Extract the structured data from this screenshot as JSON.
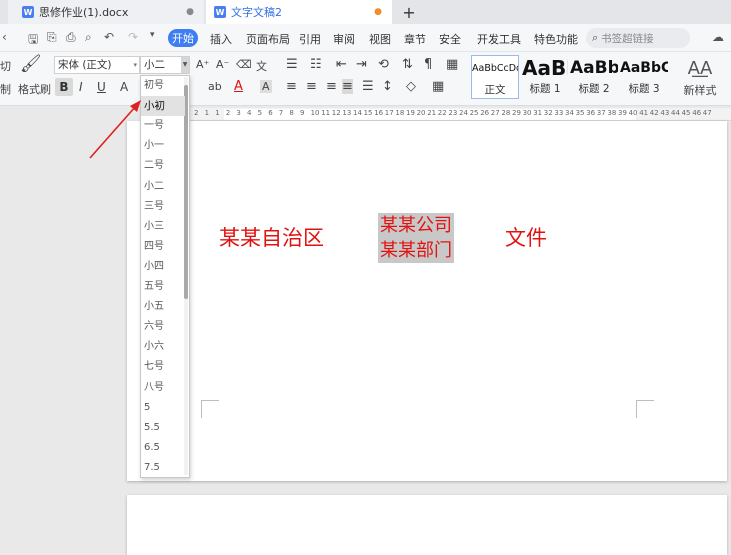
{
  "tabs": [
    {
      "label": "思修作业(1).docx",
      "icon": "W",
      "close": "●"
    },
    {
      "label": "文字文稿2",
      "icon": "W",
      "close": "●"
    }
  ],
  "tab_add": "+",
  "menu": {
    "active": "开始",
    "items": [
      "插入",
      "页面布局",
      "引用",
      "审阅",
      "视图",
      "章节",
      "安全",
      "开发工具",
      "特色功能"
    ],
    "search_placeholder": "书签超链接"
  },
  "ribbon": {
    "cut_partial": "切",
    "copy_partial": "制",
    "format_painter": "格式刷",
    "font_name": "宋体 (正文)",
    "font_size": "小二",
    "styles": [
      {
        "preview": "AaBbCcDd",
        "label": "正文"
      },
      {
        "preview": "AaBb",
        "label": "标题 1"
      },
      {
        "preview": "AaBb(",
        "label": "标题 2"
      },
      {
        "preview": "AaBbC",
        "label": "标题 3"
      }
    ],
    "new_style": "新样式"
  },
  "ruler_labels": [
    "2",
    "1",
    "1",
    "2",
    "3",
    "4",
    "5",
    "6",
    "7",
    "8",
    "9",
    "10",
    "11",
    "12",
    "13",
    "14",
    "15",
    "16",
    "17",
    "18",
    "19",
    "20",
    "21",
    "22",
    "23",
    "24",
    "25",
    "26",
    "27",
    "28",
    "29",
    "30",
    "31",
    "32",
    "33",
    "34",
    "35",
    "36",
    "37",
    "38",
    "39",
    "40",
    "41",
    "42",
    "43",
    "44",
    "45",
    "46",
    "47"
  ],
  "size_options": [
    "初号",
    "小初",
    "一号",
    "小一",
    "二号",
    "小二",
    "三号",
    "小三",
    "四号",
    "小四",
    "五号",
    "小五",
    "六号",
    "小六",
    "七号",
    "八号",
    "5",
    "5.5",
    "6.5",
    "7.5"
  ],
  "selected_size": "小初",
  "document": {
    "text1": "某某自治区",
    "text2_line1": "某某公司",
    "text2_line2": "某某部门",
    "text3": "文件"
  },
  "colors": {
    "accent": "#3e7ef2",
    "doc_text": "#e21212",
    "arrow": "#e02020"
  }
}
